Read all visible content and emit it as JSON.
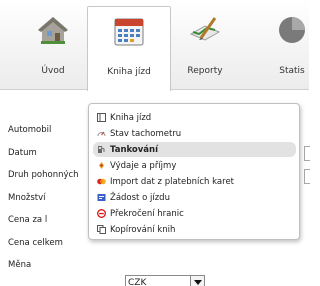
{
  "ribbon": {
    "uvod_label": "Úvod",
    "kniha_label": "Kniha jízd",
    "reporty_label": "Reporty",
    "statis_label": "Statis"
  },
  "form": {
    "labels": [
      "Automobil",
      "Datum",
      "Druh pohonných",
      "Množství",
      "Cena za l",
      "Cena celkem",
      "Měna"
    ],
    "mena_value": "CZK"
  },
  "menu": {
    "items": [
      {
        "label": "Kniha jízd",
        "icon": "book-icon"
      },
      {
        "label": "Stav tachometru",
        "icon": "speedometer-icon"
      },
      {
        "label": "Tankování",
        "icon": "fuel-pump-icon"
      },
      {
        "label": "Výdaje a příjmy",
        "icon": "money-icon"
      },
      {
        "label": "Import dat z platebních karet",
        "icon": "card-icon"
      },
      {
        "label": "Žádost o jízdu",
        "icon": "request-icon"
      },
      {
        "label": "Překročení hranic",
        "icon": "border-stop-icon"
      },
      {
        "label": "Kopírování knih",
        "icon": "copy-icon"
      }
    ],
    "selected_index": 2
  },
  "colors": {
    "accent": "#e2e2e2",
    "ribbon_border": "#c8c8c8"
  }
}
